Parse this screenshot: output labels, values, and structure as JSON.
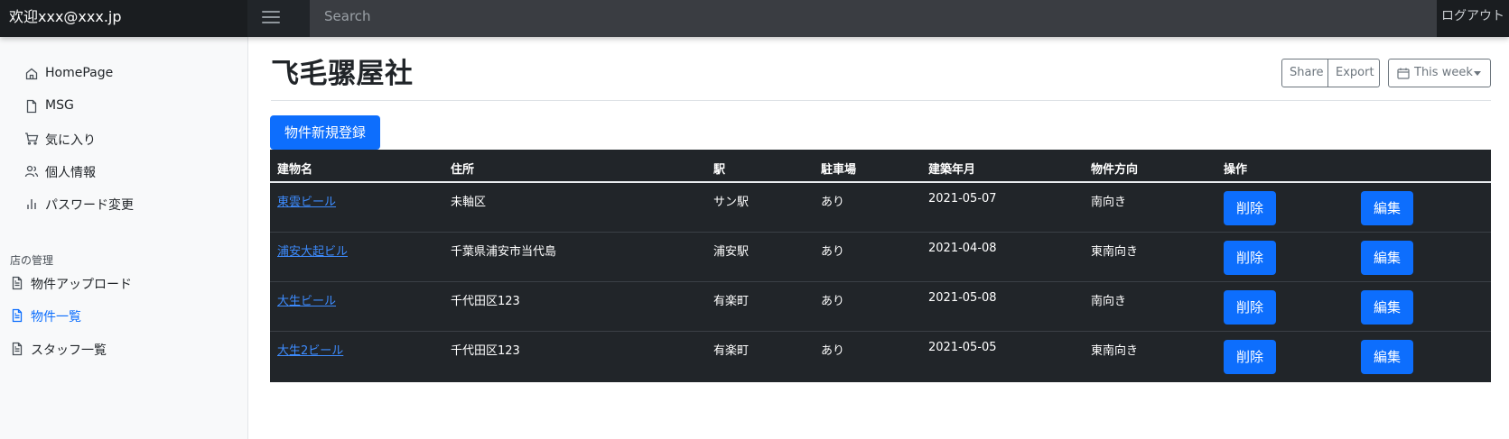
{
  "navbar": {
    "brand": "欢迎xxx@xxx.jp",
    "search_placeholder": "Search",
    "logout_label": "ログアウト"
  },
  "sidebar": {
    "items": [
      {
        "label": "HomePage",
        "icon": "home-icon"
      },
      {
        "label": "MSG",
        "icon": "file-icon"
      },
      {
        "label": "気に入り",
        "icon": "cart-icon"
      },
      {
        "label": "個人情報",
        "icon": "users-icon"
      },
      {
        "label": "パスワード変更",
        "icon": "bar-chart-icon"
      }
    ],
    "section_heading": "店の管理",
    "section_items": [
      {
        "label": "物件アップロード",
        "icon": "file-text-icon",
        "active": false
      },
      {
        "label": "物件一覧",
        "icon": "file-text-icon",
        "active": true
      },
      {
        "label": "スタッフ一覧",
        "icon": "file-text-icon",
        "active": false
      }
    ]
  },
  "main": {
    "title": "飞毛骡屋社",
    "share_label": "Share",
    "export_label": "Export",
    "week_label": "This week",
    "new_button_label": "物件新規登録"
  },
  "table": {
    "headers": [
      "建物名",
      "住所",
      "駅",
      "駐車場",
      "建築年月",
      "物件方向",
      "操作"
    ],
    "rows": [
      {
        "name": "東雲ビール",
        "address": "未軸区",
        "station": "サン駅",
        "parking": "あり",
        "built": "2021-05-07",
        "direction": "南向き",
        "delete": "削除",
        "edit": "編集"
      },
      {
        "name": "浦安大起ビル",
        "address": "千葉県浦安市当代島",
        "station": "浦安駅",
        "parking": "あり",
        "built": "2021-04-08",
        "direction": "東南向き",
        "delete": "削除",
        "edit": "編集"
      },
      {
        "name": "大生ビール",
        "address": "千代田区123",
        "station": "有楽町",
        "parking": "あり",
        "built": "2021-05-08",
        "direction": "南向き",
        "delete": "削除",
        "edit": "編集"
      },
      {
        "name": "大生2ビール",
        "address": "千代田区123",
        "station": "有楽町",
        "parking": "あり",
        "built": "2021-05-05",
        "direction": "東南向き",
        "delete": "削除",
        "edit": "編集"
      }
    ]
  },
  "colors": {
    "navbar": "#212529",
    "accent": "#0d6efd",
    "link": "#3d8bfd",
    "sidebar_bg": "#f8f9fa"
  }
}
